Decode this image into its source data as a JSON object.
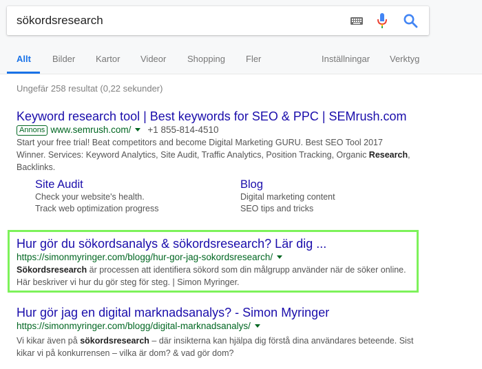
{
  "search": {
    "query": "sökordsresearch"
  },
  "tabs": {
    "all": "Allt",
    "images": "Bilder",
    "maps": "Kartor",
    "videos": "Videor",
    "shopping": "Shopping",
    "more": "Fler",
    "settings": "Inställningar",
    "tools": "Verktyg"
  },
  "stats": "Ungefär 258 resultat (0,22 sekunder)",
  "results": [
    {
      "title": "Keyword research tool | Best keywords for SEO & PPC | SEMrush.com",
      "ad_label": "Annons",
      "url": "www.semrush.com/",
      "phone": "+1 855-814-4510",
      "snippet_lines": [
        "Start your free trial! Beat competitors and become Digital Marketing GURU. Best SEO Tool 2017",
        "Winner. Services: Keyword Analytics, Site Audit, Traffic Analytics, Position Tracking, Organic ",
        "Backlinks."
      ],
      "snippet_bold": "Research",
      "snippet_comma": ",",
      "sitelinks": [
        {
          "title": "Site Audit",
          "lines": [
            "Check your website's health.",
            "Track web optimization progress"
          ]
        },
        {
          "title": "Blog",
          "lines": [
            "Digital marketing content",
            "SEO tips and tricks"
          ]
        }
      ]
    },
    {
      "title": "Hur gör du sökordsanalys & sökordsresearch? Lär dig ...",
      "url": "https://simonmyringer.com/blogg/hur-gor-jag-sokordsresearch/",
      "snippet_bold": "Sökordsresearch",
      "snippet_line1_rest": " är processen att identifiera sökord som din målgrupp använder när de söker online.",
      "snippet_line2": "Här beskriver vi hur du gör steg för steg. | Simon Myringer."
    },
    {
      "title": "Hur gör jag en digital marknadsanalys? - Simon Myringer",
      "url": "https://simonmyringer.com/blogg/digital-marknadsanalys/",
      "snippet_pre": "Vi kikar även på ",
      "snippet_bold": "sökordsresearch",
      "snippet_post": " – där insikterna kan hjälpa dig förstå dina användares beteende. Sist",
      "snippet_line2": "kikar vi på konkurrensen – vilka är dom? & vad gör dom?"
    }
  ]
}
